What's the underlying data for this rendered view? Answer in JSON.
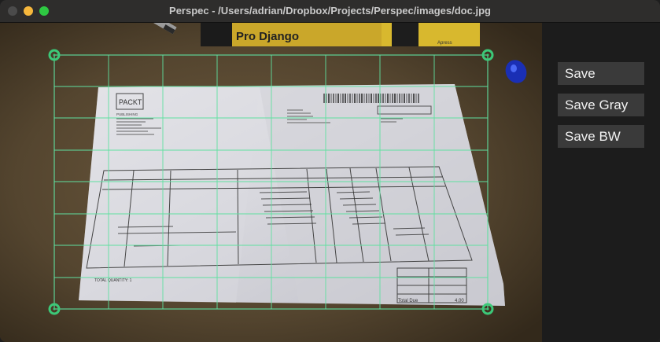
{
  "window": {
    "title": "Perspec - /Users/adrian/Dropbox/Projects/Perspec/images/doc.jpg"
  },
  "photo": {
    "book_title": "Pro Django",
    "book_publisher": "Apress",
    "doc_logo": "PACKT",
    "doc_logo_sub": "PUBLISHING",
    "footer_text": "TOTAL QUANTITY: 1",
    "total_label": "Total Due",
    "total_value": "4.00"
  },
  "grid": {
    "line_color": "#5fe0a0",
    "handle_color": "#3cc878"
  },
  "sidebar": {
    "save_label": "Save",
    "save_gray_label": "Save Gray",
    "save_bw_label": "Save BW"
  }
}
